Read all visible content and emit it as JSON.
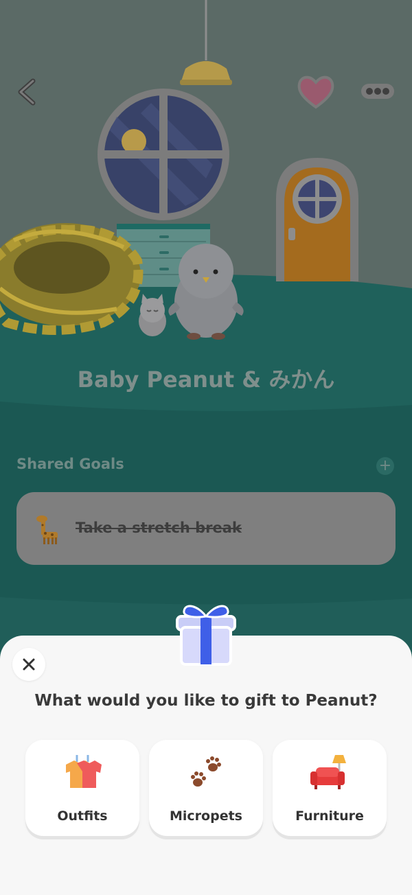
{
  "header": {
    "back_icon": "chevron-left-icon",
    "heart_icon": "heart-icon",
    "more_icon": "more-dots-icon"
  },
  "room": {
    "title": "Baby Peanut & みかん"
  },
  "goals": {
    "section_label": "Shared Goals",
    "add_icon": "plus-icon",
    "items": [
      {
        "icon": "giraffe-icon",
        "label": "Take a stretch break",
        "completed": true
      }
    ]
  },
  "gift_sheet": {
    "icon": "gift-icon",
    "close_icon": "close-icon",
    "prompt": "What would you like to gift to Peanut?",
    "options": [
      {
        "label": "Outfits",
        "icon": "outfits-icon"
      },
      {
        "label": "Micropets",
        "icon": "paw-prints-icon"
      },
      {
        "label": "Furniture",
        "icon": "sofa-lamp-icon"
      }
    ]
  },
  "colors": {
    "wall": "#5b6a66",
    "floor": "#1f615b",
    "sheet": "#f7f7f7",
    "accent_blue": "#3f5fe8"
  }
}
